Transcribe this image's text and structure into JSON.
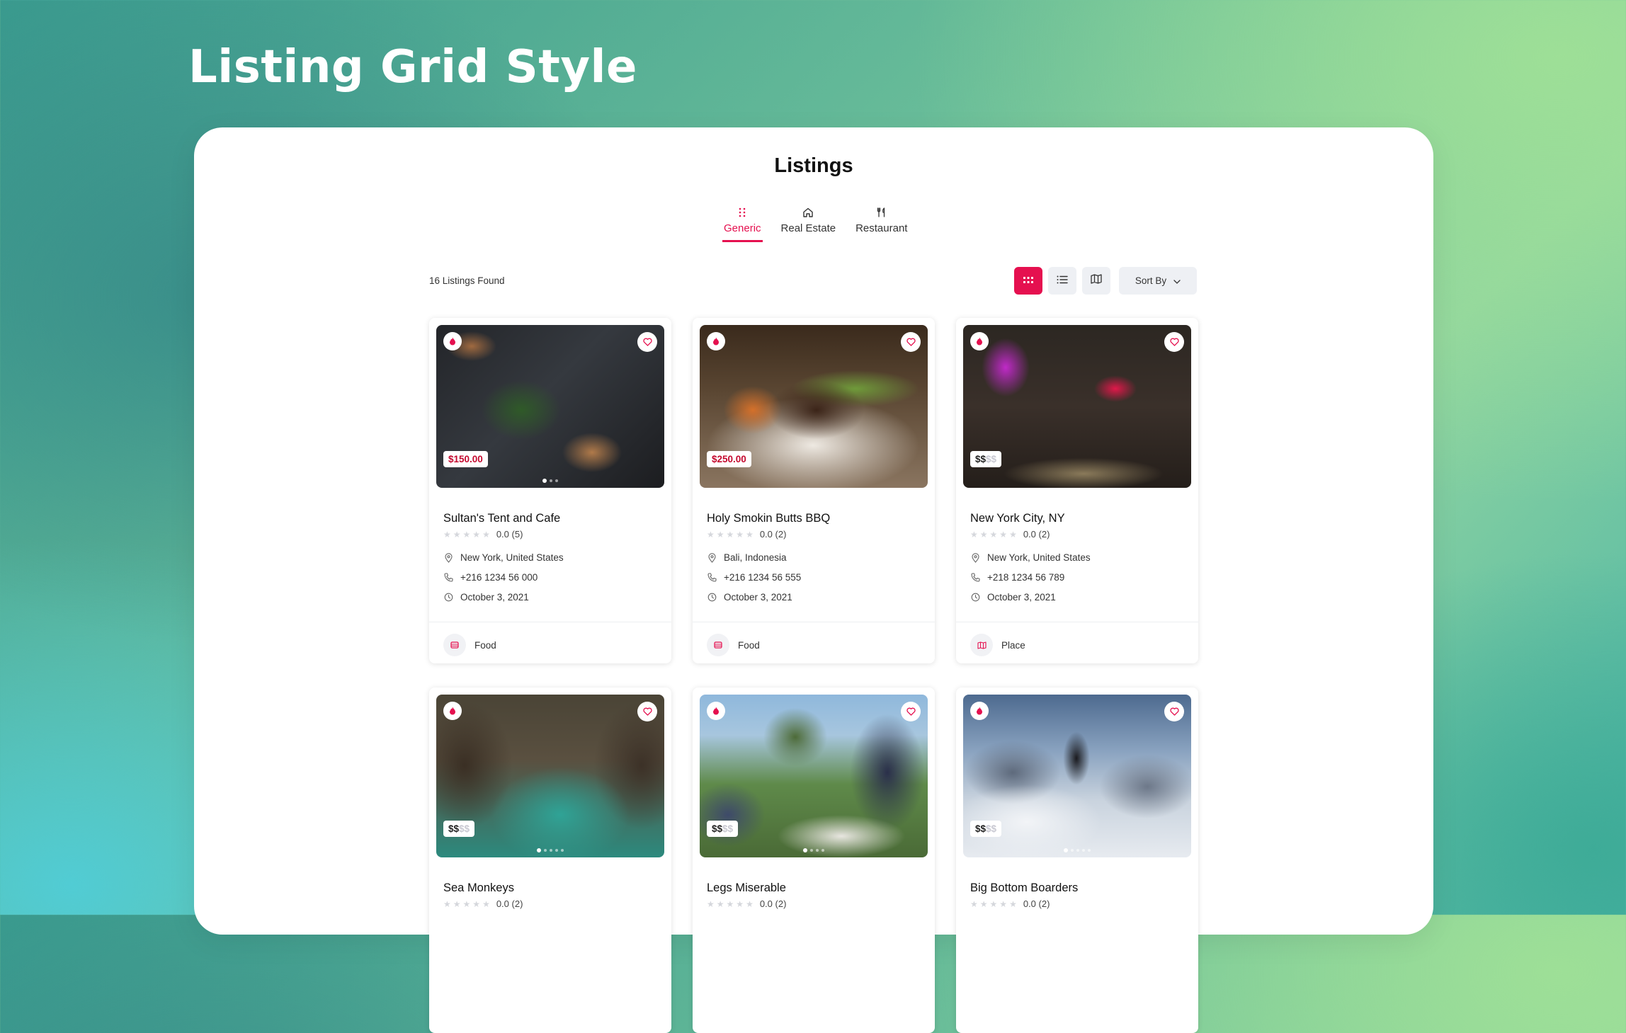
{
  "hero": {
    "title": "Listing Grid Style"
  },
  "page": {
    "title": "Listings"
  },
  "tabs": [
    {
      "label": "Generic",
      "icon": "grid-dots-icon",
      "active": true
    },
    {
      "label": "Real Estate",
      "icon": "home-icon",
      "active": false
    },
    {
      "label": "Restaurant",
      "icon": "utensils-icon",
      "active": false
    }
  ],
  "toolbar": {
    "count_text": "16 Listings Found",
    "sort_label": "Sort By",
    "views": [
      "grid-view-icon",
      "list-view-icon",
      "map-view-icon"
    ]
  },
  "colors": {
    "accent": "#e5104f",
    "price": "#c4092f"
  },
  "listings": [
    {
      "title": "Sultan's Tent and Cafe",
      "price": "$150.00",
      "rating": "0.0 (5)",
      "location": "New York, United States",
      "phone": "+216 1234 56 000",
      "date": "October 3, 2021",
      "category": "Food",
      "category_icon": "food-icon"
    },
    {
      "title": "Holy Smokin Butts BBQ",
      "price": "$250.00",
      "rating": "0.0 (2)",
      "location": "Bali, Indonesia",
      "phone": "+216 1234 56 555",
      "date": "October 3, 2021",
      "category": "Food",
      "category_icon": "food-icon"
    },
    {
      "title": "New York City, NY",
      "price_active": "$$",
      "price_dim": "$$",
      "rating": "0.0 (2)",
      "location": "New York, United States",
      "phone": "+218 1234 56 789",
      "date": "October 3, 2021",
      "category": "Place",
      "category_icon": "map-icon"
    },
    {
      "title": "Sea Monkeys",
      "price_active": "$$",
      "price_dim": "$$",
      "rating": "0.0 (2)"
    },
    {
      "title": "Legs Miserable",
      "price_active": "$$",
      "price_dim": "$$",
      "rating": "0.0 (2)"
    },
    {
      "title": "Big Bottom Boarders",
      "price_active": "$$",
      "price_dim": "$$",
      "rating": "0.0 (2)"
    }
  ]
}
